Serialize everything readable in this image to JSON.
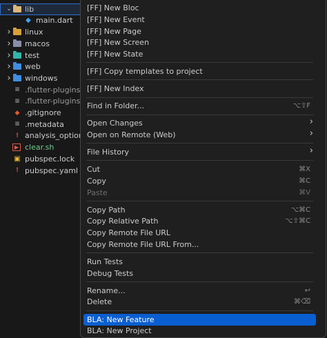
{
  "explorer": {
    "items": [
      {
        "label": "lib",
        "chevron": "v",
        "icon": "folder-open-icon",
        "color": "#dcb67a",
        "label_color": "#cccccc"
      },
      {
        "label": "main.dart",
        "chevron": "",
        "icon": "dart-icon",
        "color": "#42a5f5",
        "label_color": "#cccccc"
      },
      {
        "label": "linux",
        "chevron": ">",
        "icon": "folder-icon",
        "color": "#d8a03a",
        "label_color": "#cccccc"
      },
      {
        "label": "macos",
        "chevron": ">",
        "icon": "folder-icon",
        "color": "#8a8fa8",
        "label_color": "#cccccc"
      },
      {
        "label": "test",
        "chevron": ">",
        "icon": "folder-icon",
        "color": "#32b4a8",
        "label_color": "#cccccc"
      },
      {
        "label": "web",
        "chevron": ">",
        "icon": "folder-icon",
        "color": "#3f8ee0",
        "label_color": "#cccccc"
      },
      {
        "label": "windows",
        "chevron": ">",
        "icon": "folder-icon",
        "color": "#3f8ee0",
        "label_color": "#cccccc"
      },
      {
        "label": ".flutter-plugins",
        "chevron": "",
        "icon": "file-icon",
        "color": "#9a9a9a",
        "label_color": "#9a9a9a"
      },
      {
        "label": ".flutter-plugins-",
        "chevron": "",
        "icon": "file-icon",
        "color": "#9a9a9a",
        "label_color": "#9a9a9a"
      },
      {
        "label": ".gitignore",
        "chevron": "",
        "icon": "git-icon",
        "color": "#e8582c",
        "label_color": "#cccccc"
      },
      {
        "label": ".metadata",
        "chevron": "",
        "icon": "file-icon",
        "color": "#9a9a9a",
        "label_color": "#cccccc"
      },
      {
        "label": "analysis_option",
        "chevron": "",
        "icon": "yaml-icon",
        "color": "#d04a4a",
        "label_color": "#cccccc"
      },
      {
        "label": "clear.sh",
        "chevron": "",
        "icon": "terminal-icon",
        "color": "#e05a4a",
        "label_color": "#73c991"
      },
      {
        "label": "pubspec.lock",
        "chevron": "",
        "icon": "lock-icon",
        "color": "#e8b72c",
        "label_color": "#cccccc"
      },
      {
        "label": "pubspec.yaml",
        "chevron": "",
        "icon": "yaml-icon",
        "color": "#d04a4a",
        "label_color": "#cccccc"
      }
    ]
  },
  "menu": {
    "groups": [
      [
        {
          "label": "[FF] New Bloc"
        },
        {
          "label": "[FF] New Event"
        },
        {
          "label": "[FF] New Page"
        },
        {
          "label": "[FF] New Screen"
        },
        {
          "label": "[FF] New State"
        }
      ],
      [
        {
          "label": "[FF] Copy templates to project"
        }
      ],
      [
        {
          "label": "[FF] New Index"
        }
      ],
      [
        {
          "label": "Find in Folder...",
          "shortcut": "⌥⇧F"
        }
      ],
      [
        {
          "label": "Open Changes",
          "submenu": true
        },
        {
          "label": "Open on Remote (Web)",
          "submenu": true
        }
      ],
      [
        {
          "label": "File History",
          "submenu": true
        }
      ],
      [
        {
          "label": "Cut",
          "shortcut": "⌘X"
        },
        {
          "label": "Copy",
          "shortcut": "⌘C"
        },
        {
          "label": "Paste",
          "shortcut": "⌘V",
          "disabled": true
        }
      ],
      [
        {
          "label": "Copy Path",
          "shortcut": "⌥⌘C"
        },
        {
          "label": "Copy Relative Path",
          "shortcut": "⌥⇧⌘C"
        },
        {
          "label": "Copy Remote File URL"
        },
        {
          "label": "Copy Remote File URL From..."
        }
      ],
      [
        {
          "label": "Run Tests"
        },
        {
          "label": "Debug Tests"
        }
      ],
      [
        {
          "label": "Rename...",
          "shortcut": "↩"
        },
        {
          "label": "Delete",
          "shortcut": "⌘⌫"
        }
      ],
      [
        {
          "label": "BLA: New Feature",
          "highlighted": true
        },
        {
          "label": "BLA: New Project"
        }
      ]
    ],
    "submenu_arrow": "›"
  },
  "colors": {
    "accent": "#0a5fd0",
    "menu_bg": "#1f1f1f",
    "sidebar_bg": "#181818"
  }
}
